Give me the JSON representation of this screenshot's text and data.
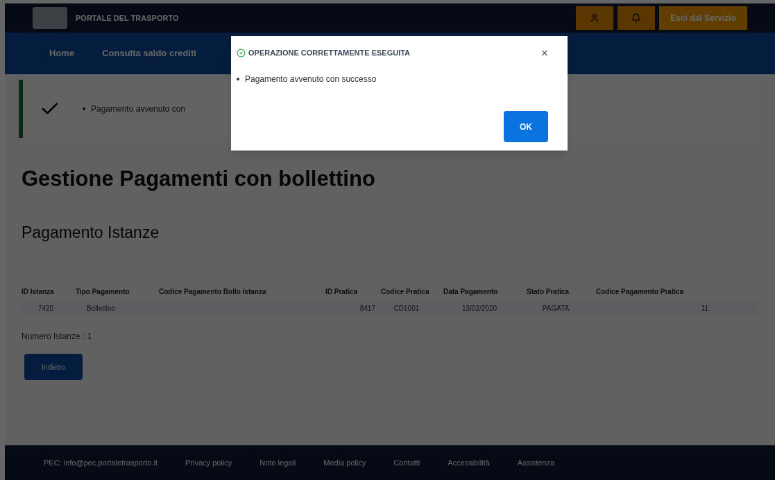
{
  "header": {
    "title": "PORTALE DEL TRASPORTO",
    "logout": "Esci dal Servizio"
  },
  "nav": {
    "items": [
      "Home",
      "Consulta saldo crediti"
    ]
  },
  "alert": {
    "message": "Pagamento avvenuto con"
  },
  "page": {
    "title": "Gestione Pagamenti con bollettino",
    "subtitle": "Pagamento Istanze"
  },
  "table": {
    "columns": [
      "ID Istanza",
      "Tipo Pagamento",
      "Codice Pagamento Bollo Istanza",
      "ID Pratica",
      "Codice Pratica",
      "Data Pagamento",
      "Stato Pratica",
      "Codice Pagamento Pratica"
    ],
    "rows": [
      {
        "cells": [
          "7420",
          "Bollettino",
          null,
          "8417",
          "CD1001",
          "13/02/2020",
          "PAGATA",
          "11"
        ]
      }
    ]
  },
  "count": "Numero Istanze : 1",
  "back_button": "Indietro",
  "footer": {
    "links": [
      "PEC: info@pec.portaletrasporto.it",
      "Privacy policy",
      "Note legali",
      "Media policy",
      "Contatti",
      "Accessibilità",
      "Assistenza"
    ]
  },
  "modal": {
    "title": "OPERAZIONE CORRETTAMENTE ESEGUITA",
    "close": "×",
    "messages": [
      "Pagamento avvenuto con successo"
    ],
    "ok": "OK"
  }
}
